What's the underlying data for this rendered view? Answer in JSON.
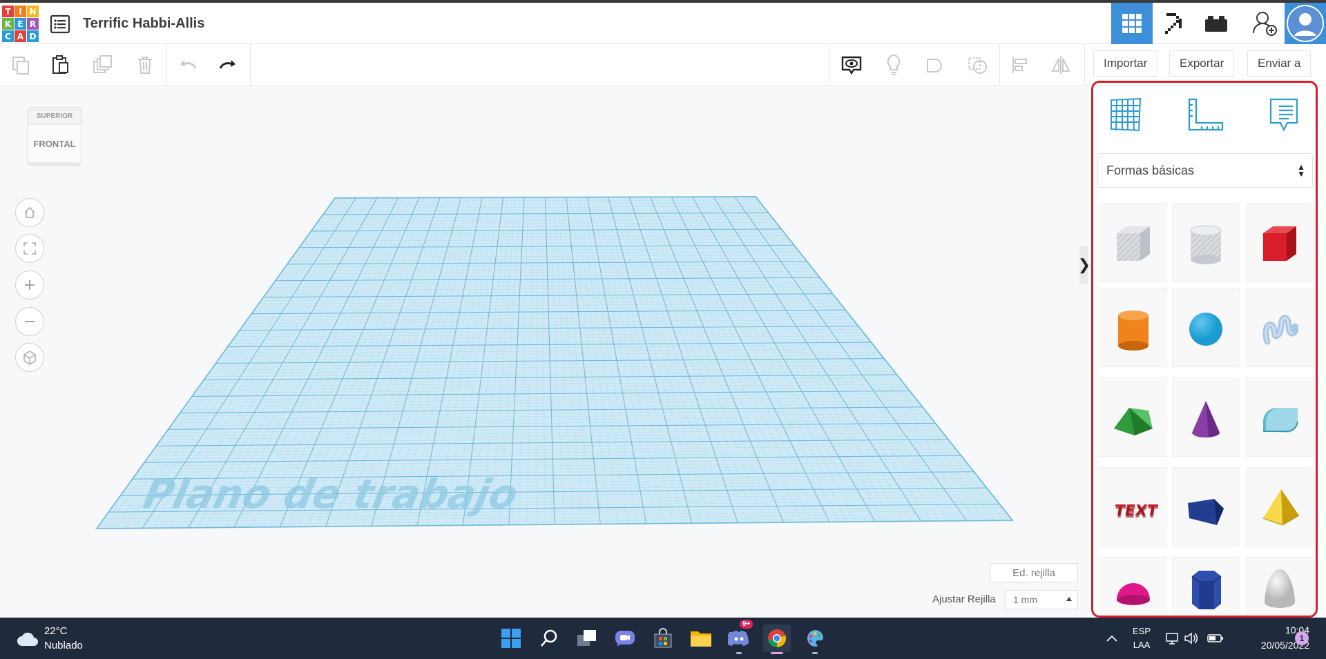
{
  "header": {
    "logo_letters": [
      "T",
      "I",
      "N",
      "K",
      "E",
      "R",
      "C",
      "A",
      "D"
    ],
    "logo_colors": [
      "#e2403c",
      "#f47d20",
      "#f9b51a",
      "#6ab64a",
      "#2b9ad8",
      "#9b59b6",
      "#2b9ad8",
      "#e2403c",
      "#2b9ad8"
    ],
    "doc_title": "Terrific Habbi-Allis",
    "nav_icons": [
      "grid-view-icon",
      "pickaxe-icon",
      "brick-icon",
      "add-user-icon",
      "user-avatar-icon"
    ],
    "accent": "#3d8fd9"
  },
  "toolbar": {
    "icons": [
      "copy-icon",
      "paste-icon",
      "duplicate-icon",
      "delete-icon",
      "undo-icon",
      "redo-icon"
    ],
    "view_icons": [
      "show-all-icon",
      "light-bulb-icon",
      "shape-solid-icon",
      "shape-hole-icon",
      "align-icon",
      "mirror-icon"
    ],
    "import_label": "Importar",
    "export_label": "Exportar",
    "send_label": "Enviar a"
  },
  "viewport": {
    "viewcube_top": "SUPERIOR",
    "viewcube_front": "FRONTAL",
    "nav_icons": [
      "home-view-icon",
      "fit-all-icon",
      "zoom-in-icon",
      "zoom-out-icon",
      "perspective-icon"
    ],
    "workplane_label": "Plano de trabajo",
    "workplane_color": "#9fd6ee",
    "edit_grid_label": "Ed. rejilla",
    "snap_label": "Ajustar Rejilla",
    "snap_value": "1 mm"
  },
  "panel": {
    "top_icons": [
      "workplane-grid-icon",
      "ruler-icon",
      "notes-icon"
    ],
    "category": "Formas básicas",
    "shapes": [
      {
        "name": "box-hole",
        "color": "#c8ccd2"
      },
      {
        "name": "cylinder-hole",
        "color": "#c8ccd2"
      },
      {
        "name": "box",
        "color": "#d71e29"
      },
      {
        "name": "cylinder",
        "color": "#f0841c"
      },
      {
        "name": "sphere",
        "color": "#1a9cd1"
      },
      {
        "name": "scribble",
        "color": "#a9c6e2"
      },
      {
        "name": "roof",
        "color": "#2f9c3b"
      },
      {
        "name": "cone",
        "color": "#8a3fa6"
      },
      {
        "name": "round-roof",
        "color": "#5cbad0"
      },
      {
        "name": "text",
        "color": "#c8202c"
      },
      {
        "name": "wedge",
        "color": "#213e91"
      },
      {
        "name": "pyramid",
        "color": "#f2c416"
      },
      {
        "name": "half-sphere",
        "color": "#e0198a"
      },
      {
        "name": "polygon",
        "color": "#1f3c8f"
      },
      {
        "name": "paraboloid",
        "color": "#d9d9d9"
      }
    ],
    "frame_color": "#d31f2c"
  },
  "taskbar": {
    "temperature": "22°C",
    "weather": "Nublado",
    "apps": [
      "start-icon",
      "search-icon",
      "task-view-icon",
      "chat-icon",
      "store-icon",
      "file-explorer-icon",
      "discord-icon",
      "chrome-icon",
      "paint-icon"
    ],
    "discord_badge": "9+",
    "lang_top": "ESP",
    "lang_bottom": "LAA",
    "time": "10:04",
    "date": "20/05/2022",
    "notification_count": "1"
  }
}
